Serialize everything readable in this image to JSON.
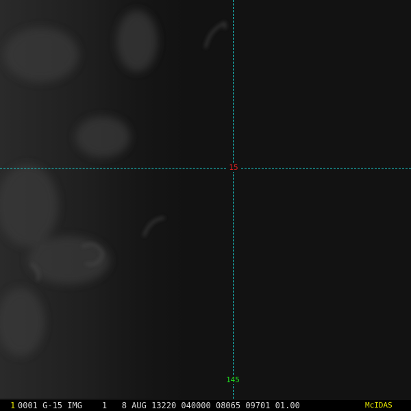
{
  "overlay": {
    "latitude_label": "15",
    "longitude_label": "145",
    "grid_color": "#19c8c8",
    "latitude_color": "#e02020",
    "longitude_color": "#20e020"
  },
  "footer": {
    "frame_number": "1",
    "frame_number_color": "#e0e000",
    "header_text": "0001 G-15 IMG    1   8 AUG 13220 040000 08065 09701 01.00",
    "header_color": "#d8d8d8",
    "brand": "McIDAS",
    "brand_color": "#e0e000"
  }
}
